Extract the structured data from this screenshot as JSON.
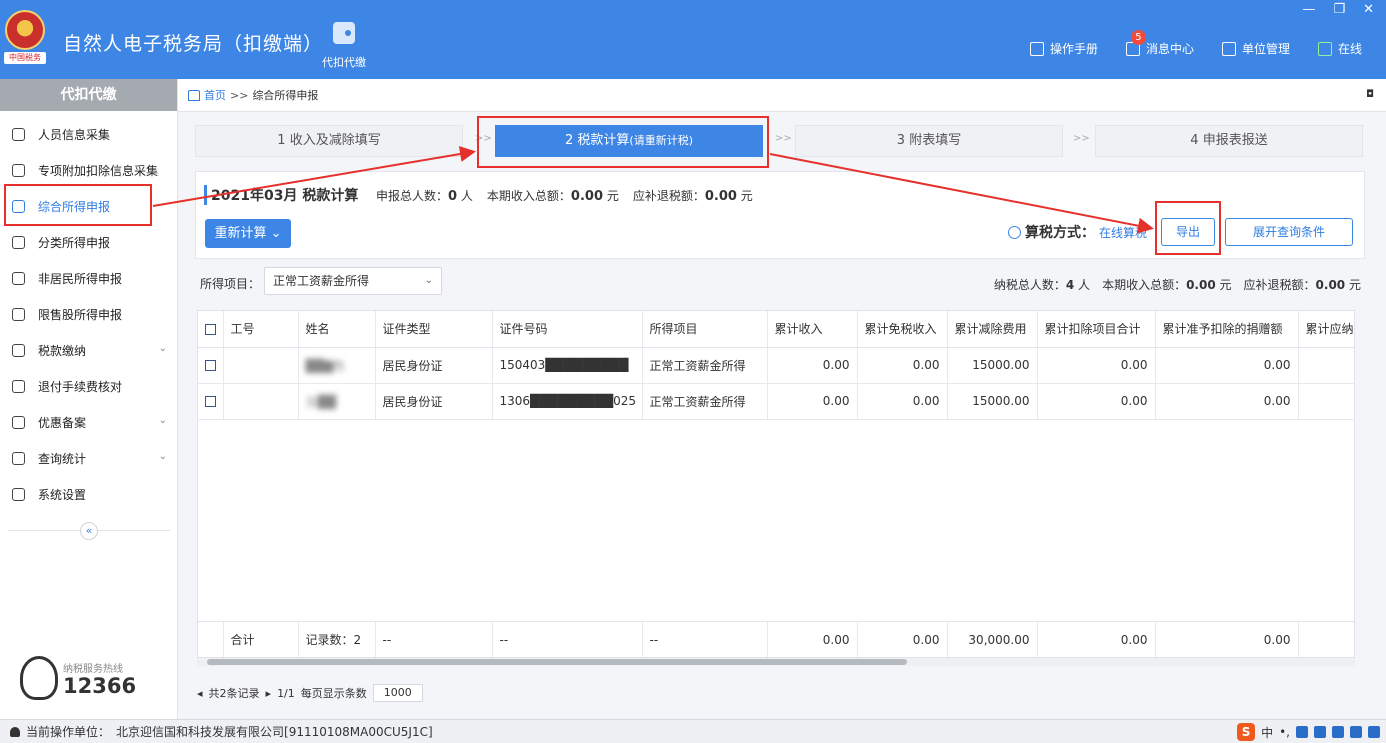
{
  "header": {
    "title": "自然人电子税务局（扣缴端）",
    "emblem_text": "中国税务",
    "module_label": "代扣代缴",
    "links": [
      {
        "label": "操作手册",
        "icon": "manual-icon"
      },
      {
        "label": "消息中心",
        "icon": "mail-icon",
        "badge": "5"
      },
      {
        "label": "单位管理",
        "icon": "building-icon"
      },
      {
        "label": "在线",
        "icon": "online-icon"
      }
    ],
    "window_controls": {
      "minimize": "—",
      "restore": "❐",
      "close": "✕"
    }
  },
  "sidebar": {
    "heading": "代扣代缴",
    "items": [
      {
        "label": "人员信息采集",
        "icon": "user-icon"
      },
      {
        "label": "专项附加扣除信息采集",
        "icon": "list-icon"
      },
      {
        "label": "综合所得申报",
        "icon": "layers-icon",
        "active": true
      },
      {
        "label": "分类所得申报",
        "icon": "pie-icon"
      },
      {
        "label": "非居民所得申报",
        "icon": "person-icon"
      },
      {
        "label": "限售股所得申报",
        "icon": "bar-chart-icon"
      },
      {
        "label": "税款缴纳",
        "icon": "wallet-icon",
        "expandable": true
      },
      {
        "label": "退付手续费核对",
        "icon": "receipt-icon"
      },
      {
        "label": "优惠备案",
        "icon": "file-icon",
        "expandable": true
      },
      {
        "label": "查询统计",
        "icon": "search-list-icon",
        "expandable": true
      },
      {
        "label": "系统设置",
        "icon": "gear-icon"
      }
    ],
    "collapse": "«",
    "hotline_label": "纳税服务热线",
    "hotline_number": "12366"
  },
  "breadcrumb": {
    "home": "首页",
    "sep": ">>",
    "current": "综合所得申报",
    "close": "◘"
  },
  "steps": [
    {
      "label": "1 收入及减除填写",
      "sub": ""
    },
    {
      "label": "2 税款计算",
      "sub": "(请重新计税)",
      "active": true
    },
    {
      "label": "3 附表填写",
      "sub": ""
    },
    {
      "label": "4 申报表报送",
      "sub": ""
    }
  ],
  "step_arrow": ">>",
  "calc": {
    "title": "2021年03月  税款计算",
    "total_people_label": "申报总人数：",
    "total_people": "0",
    "people_unit": "人",
    "income_label": "本期收入总额：",
    "income": "0.00",
    "income_unit": "元",
    "refund_label": "应补退税额：",
    "refund": "0.00",
    "refund_unit": "元",
    "recalc_button": "重新计算 ⌄",
    "tax_method_label": "算税方式：",
    "tax_method_value": "在线算税",
    "export_button": "导出",
    "expand_button": "展开查询条件"
  },
  "filter": {
    "label": "所得项目：",
    "selected": "正常工资薪金所得",
    "taxpayer_label": "纳税总人数：",
    "taxpayer_count": "4",
    "taxpayer_unit": "人",
    "income_label": "本期收入总额：",
    "income": "0.00",
    "income_unit": "元",
    "refund_label": "应补退税额：",
    "refund": "0.00",
    "refund_unit": "元"
  },
  "table": {
    "columns": [
      "",
      "工号",
      "姓名",
      "证件类型",
      "证件号码",
      "所得项目",
      "累计收入",
      "累计免税收入",
      "累计减除费用",
      "累计扣除项目合计",
      "累计准予扣除的捐赠额",
      "累计应纳"
    ],
    "rows": [
      [
        "",
        "",
        "██▇色",
        "居民身份证",
        "150403█████████",
        "正常工资薪金所得",
        "0.00",
        "0.00",
        "15000.00",
        "0.00",
        "0.00",
        ""
      ],
      [
        "",
        "",
        "汝██",
        "居民身份证",
        "1306█████████025",
        "正常工资薪金所得",
        "0.00",
        "0.00",
        "15000.00",
        "0.00",
        "0.00",
        ""
      ]
    ],
    "total": [
      "",
      "合计",
      "记录数：2",
      "--",
      "--",
      "--",
      "0.00",
      "0.00",
      "30,000.00",
      "0.00",
      "0.00",
      ""
    ]
  },
  "pager": {
    "records": "共2条记录",
    "pages": "1/1",
    "per_page_label": "每页显示条数",
    "per_page": "1000"
  },
  "status": {
    "unit_label": "当前操作单位：",
    "unit": "北京迎信国和科技发展有限公司[91110108MA00CU5J1C]"
  },
  "ime": {
    "logo": "S",
    "lang": "中",
    "punct": "•,"
  },
  "colors": {
    "header_bg": "#3e86e5",
    "accent": "#2f7de1",
    "highlight": "#e5302b"
  }
}
